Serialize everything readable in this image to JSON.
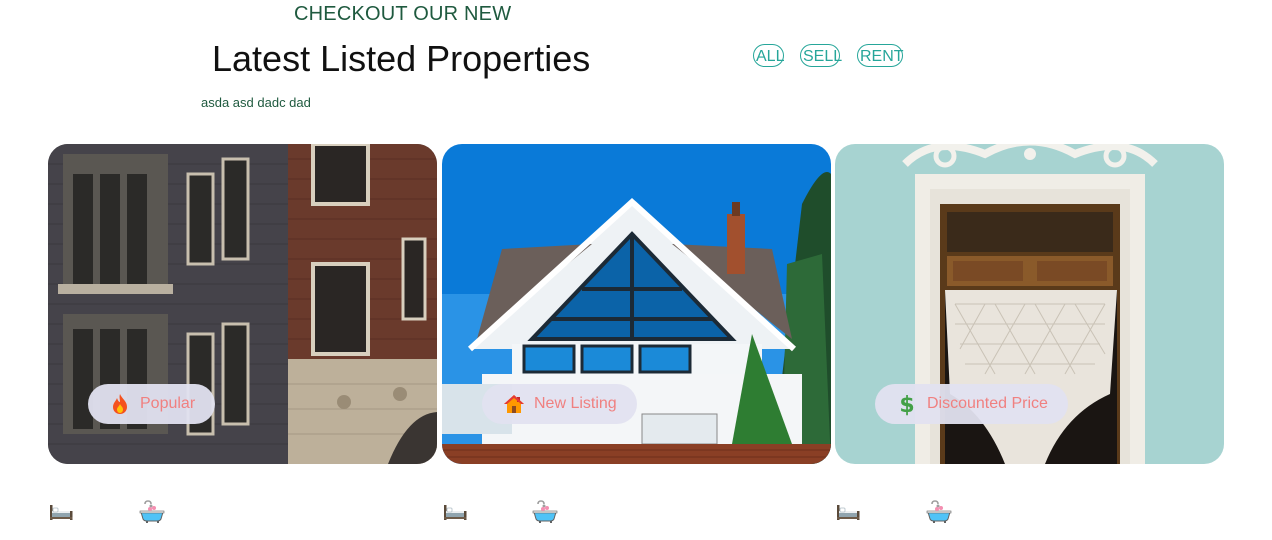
{
  "header": {
    "eyebrow": "CHECKOUT OUR NEW",
    "title": "Latest Listed Properties",
    "subtitle": "asda asd dadc dad"
  },
  "filters": [
    {
      "label": "ALL"
    },
    {
      "label": "SELL"
    },
    {
      "label": "RENT"
    }
  ],
  "listings": [
    {
      "badge": "Popular",
      "badge_icon": "fire-icon",
      "amenity_icons": [
        "bed-icon",
        "bathtub-icon"
      ]
    },
    {
      "badge": "New Listing",
      "badge_icon": "house-icon",
      "amenity_icons": [
        "bed-icon",
        "bathtub-icon"
      ]
    },
    {
      "badge": "Discounted Price",
      "badge_icon": "dollar-icon",
      "amenity_icons": [
        "bed-icon",
        "bathtub-icon"
      ]
    }
  ],
  "colors": {
    "accent": "#26a69a",
    "heading_green": "#1f5a3f",
    "badge_text": "#f08080",
    "badge_bg": "#e2e2f0"
  }
}
